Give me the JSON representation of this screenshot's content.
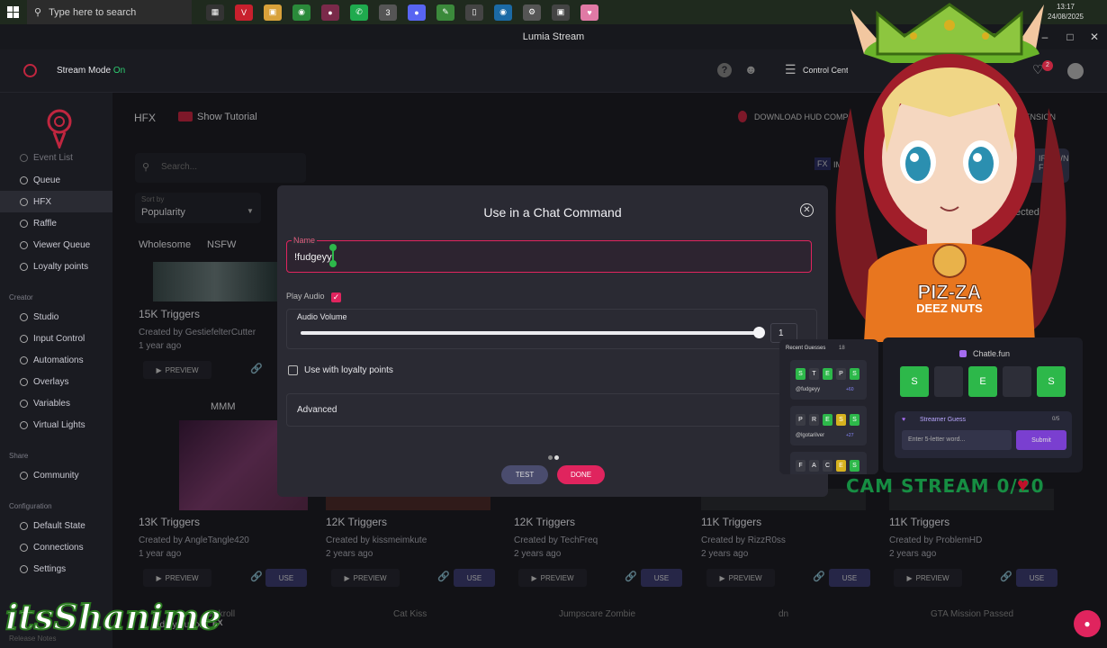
{
  "taskbar": {
    "search_placeholder": "Type here to search",
    "time": "13:17",
    "date": "24/08/2025"
  },
  "window": {
    "title": "Lumia Stream"
  },
  "header": {
    "stream_mode_label": "Stream Mode",
    "stream_mode_state": "On",
    "control_center": "Control Center",
    "notification_count": "2"
  },
  "sidebar": {
    "items_top": [
      {
        "label": "Event List"
      },
      {
        "label": "Queue"
      },
      {
        "label": "HFX",
        "active": true
      },
      {
        "label": "Raffle"
      },
      {
        "label": "Viewer Queue"
      },
      {
        "label": "Loyalty points"
      }
    ],
    "section_creator": "Creator",
    "items_creator": [
      {
        "label": "Studio"
      },
      {
        "label": "Input Control"
      },
      {
        "label": "Automations"
      },
      {
        "label": "Overlays"
      },
      {
        "label": "Variables"
      },
      {
        "label": "Virtual Lights"
      }
    ],
    "section_share": "Share",
    "items_share": [
      {
        "label": "Community"
      }
    ],
    "section_config": "Configuration",
    "items_config": [
      {
        "label": "Default State"
      },
      {
        "label": "Connections"
      },
      {
        "label": "Settings"
      }
    ],
    "footer": "Release Notes"
  },
  "main": {
    "page_title": "HFX",
    "show_tutorial": "Show Tutorial",
    "download_hud": "DOWNLOAD HUD COMP",
    "extension": "TENSION",
    "search_placeholder": "Search...",
    "sort_label": "Sort by",
    "sort_value": "Popularity",
    "filters": [
      "Wholesome",
      "NSFW"
    ],
    "make_own": "IR OWN\nFX",
    "selected_text": "ected",
    "import_text": "IM",
    "preview_label": "PREVIEW",
    "use_label": "USE",
    "row1": [
      {
        "triggers": "15K Triggers",
        "creator": "Created by GestiefelterCutter",
        "ago": "1 year ago"
      }
    ],
    "row2": [
      {
        "title": "MMM",
        "triggers": "13K Triggers",
        "creator": "Created by AngleTangle420",
        "ago": "1 year ago"
      },
      {
        "triggers": "12K Triggers",
        "creator": "Created by kissmeimkute",
        "ago": "2 years ago"
      },
      {
        "triggers": "12K Triggers",
        "creator": "Created by TechFreq",
        "ago": "2 years ago"
      },
      {
        "triggers": "11K Triggers",
        "creator": "Created by RizzR0ss",
        "ago": "2 years ago"
      },
      {
        "triggers": "11K Triggers",
        "creator": "Created by ProblemHD",
        "ago": "2 years ago"
      }
    ],
    "row3_titles": [
      "dickroll",
      "Cat Kiss",
      "Jumpscare Zombie",
      "dn",
      "GTA Mission Passed"
    ],
    "row3_creator": "ed by hudfx"
  },
  "modal": {
    "title": "Use in a Chat Command",
    "name_label": "Name",
    "name_value": "!fudgeyy",
    "play_audio_label": "Play Audio",
    "play_audio_checked": true,
    "audio_volume_label": "Audio Volume",
    "audio_volume_value": "1",
    "audio_volume_fraction": 1.0,
    "loyalty_label": "Use with loyalty points",
    "loyalty_checked": false,
    "advanced_label": "Advanced",
    "test_button": "TEST",
    "done_button": "DONE",
    "accent": "#e0245e"
  },
  "overlay_graphics": {
    "shirt_text_1": "PIZ-ZA",
    "shirt_text_2": "DEEZ NUTS",
    "recent_guesses_title": "Recent Guesses",
    "recent_guesses_count": "18",
    "guess_rows": [
      {
        "letters": [
          "S",
          "T",
          "E",
          "P",
          "S"
        ],
        "colors": [
          "#2db84a",
          "#3a3b44",
          "#2db84a",
          "#3a3b44",
          "#2db84a"
        ],
        "user": "@fudgeyy",
        "points": "+60"
      },
      {
        "letters": [
          "P",
          "R",
          "E",
          "S",
          "S"
        ],
        "colors": [
          "#3a3b44",
          "#3a3b44",
          "#2db84a",
          "#d6b21f",
          "#2db84a"
        ],
        "user": "@lgotarilver",
        "points": "+27"
      },
      {
        "letters": [
          "F",
          "A",
          "C",
          "E",
          "S"
        ],
        "colors": [
          "#3a3b44",
          "#3a3b44",
          "#3a3b44",
          "#d6b21f",
          "#2db84a"
        ],
        "user": "",
        "points": ""
      }
    ],
    "chatle_title": "Chatle.fun",
    "big_tiles": [
      "S",
      "",
      "E",
      "",
      "S"
    ],
    "streamer_guess_label": "Streamer Guess",
    "streamer_guess_count": "0/5",
    "word_placeholder": "Enter 5-letter word...",
    "submit_label": "Submit",
    "cam_stream_text": "CAM STREAM 0/20",
    "watermark": "itsShanime"
  }
}
